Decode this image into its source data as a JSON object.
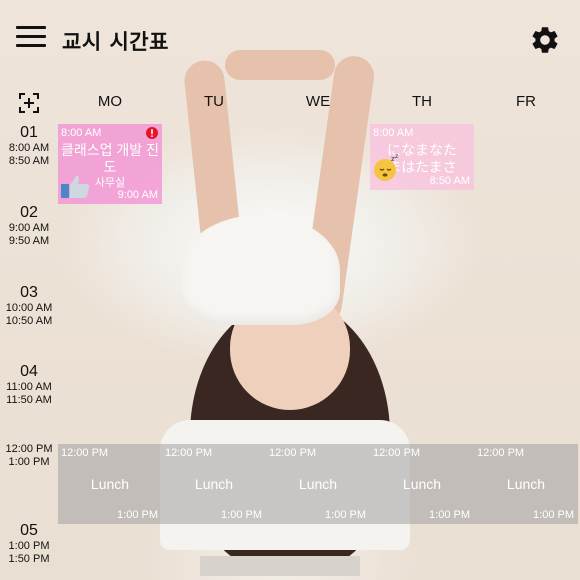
{
  "app": {
    "title": "교시 시간표"
  },
  "days": [
    "MO",
    "TU",
    "WE",
    "TH",
    "FR"
  ],
  "periods": [
    {
      "num": "01",
      "start": "8:00 AM",
      "end": "8:50 AM"
    },
    {
      "num": "02",
      "start": "9:00 AM",
      "end": "9:50 AM"
    },
    {
      "num": "03",
      "start": "10:00 AM",
      "end": "10:50 AM"
    },
    {
      "num": "04",
      "start": "11:00 AM",
      "end": "11:50 AM"
    },
    {
      "num": "",
      "start": "12:00 PM",
      "end": "1:00 PM"
    },
    {
      "num": "05",
      "start": "1:00 PM",
      "end": "1:50 PM"
    }
  ],
  "courses": [
    {
      "day": "MO",
      "start": "8:00 AM",
      "end": "9:00 AM",
      "name": "클래스업 개발 진도",
      "room": "사무실",
      "alert": true
    },
    {
      "day": "TH",
      "start": "8:00 AM",
      "end": "8:50 AM",
      "name": "になまなたまはたまさ",
      "room": "",
      "alert": false
    }
  ],
  "lunch": [
    {
      "day": "MO",
      "start": "12:00 PM",
      "end": "1:00 PM",
      "name": "Lunch"
    },
    {
      "day": "TU",
      "start": "12:00 PM",
      "end": "1:00 PM",
      "name": "Lunch"
    },
    {
      "day": "WE",
      "start": "12:00 PM",
      "end": "1:00 PM",
      "name": "Lunch"
    },
    {
      "day": "TH",
      "start": "12:00 PM",
      "end": "1:00 PM",
      "name": "Lunch"
    },
    {
      "day": "FR",
      "start": "12:00 PM",
      "end": "1:00 PM",
      "name": "Lunch"
    }
  ],
  "icons": {
    "menu": "menu-icon",
    "settings": "gear-icon",
    "add": "add-schedule-icon",
    "alert": "alert-icon",
    "sticker_thumbs": "thumbs-up-sticker",
    "sticker_sleep": "sleeping-emoji-sticker"
  },
  "colors": {
    "course": "#f48ad6",
    "course_light": "#fcb9e1",
    "lunch": "#a0a0a0",
    "alert": "#e8132b"
  }
}
